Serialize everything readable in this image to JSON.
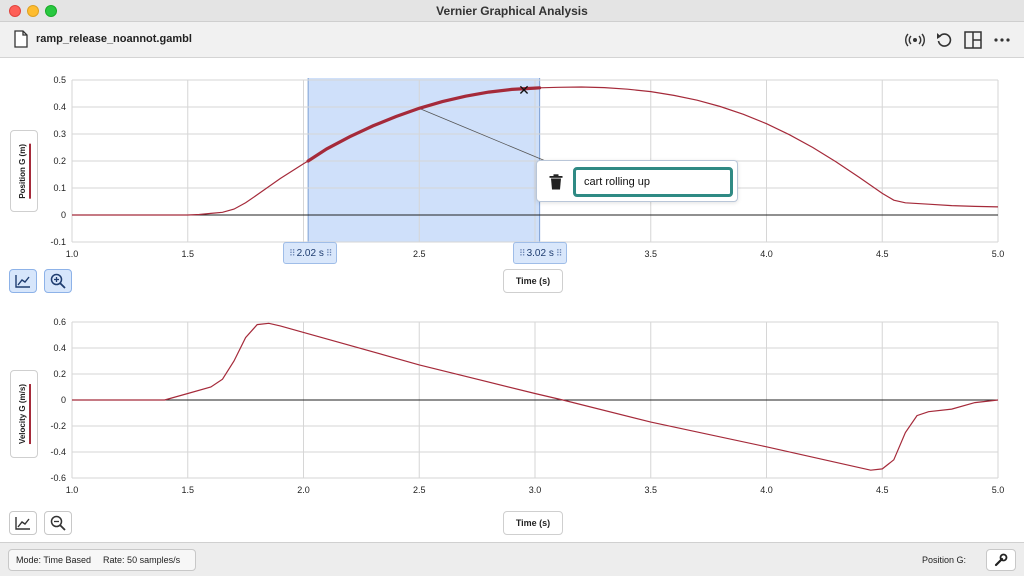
{
  "window": {
    "title": "Vernier Graphical Analysis"
  },
  "toolbar": {
    "file_name": "ramp_release_noannot.gambl",
    "icons": [
      "file-icon",
      "sensor-broadcast-icon",
      "undo-icon",
      "layout-icon",
      "more-icon"
    ]
  },
  "graph1": {
    "ylabel": "Position G (m)",
    "xlabel": "Time (s)",
    "selection": {
      "start_label": "2.02 s",
      "end_label": "3.02 s",
      "start": 2.02,
      "end": 3.02
    },
    "annotation": {
      "text": "cart rolling up"
    },
    "tools": [
      "graph-options-icon",
      "zoom-in-icon"
    ]
  },
  "graph2": {
    "ylabel": "Velocity G (m/s)",
    "xlabel": "Time (s)",
    "tools": [
      "graph-options-icon",
      "zoom-out-icon"
    ]
  },
  "status": {
    "mode": "Mode: Time Based",
    "rate": "Rate: 50 samples/s",
    "sensor_label": "Position G:"
  },
  "colors": {
    "trace": "#a52a3a",
    "selection": "#cfe0fa",
    "accent": "#2f8a84"
  },
  "chart_data": [
    {
      "type": "line",
      "xlabel": "Time (s)",
      "ylabel": "Position G (m)",
      "xlim": [
        1.0,
        5.0
      ],
      "ylim": [
        -0.1,
        0.5
      ],
      "xticks": [
        "1.0",
        "1.5",
        "2.0",
        "2.5",
        "3.0",
        "3.5",
        "4.0",
        "4.5",
        "5.0"
      ],
      "yticks": [
        "-0.1",
        "0",
        "0.1",
        "0.2",
        "0.3",
        "0.4",
        "0.5"
      ],
      "grid": true,
      "series": [
        {
          "x": [
            1.0,
            1.5,
            1.55,
            1.6,
            1.65,
            1.7,
            1.75,
            1.8,
            1.9,
            2.0,
            2.02,
            2.1,
            2.2,
            2.3,
            2.4,
            2.5,
            2.6,
            2.7,
            2.8,
            2.9,
            3.0,
            3.02,
            3.1,
            3.2,
            3.3,
            3.4,
            3.5,
            3.6,
            3.7,
            3.8,
            3.9,
            4.0,
            4.1,
            4.2,
            4.3,
            4.4,
            4.5,
            4.55,
            4.6,
            4.7,
            4.8,
            4.9,
            5.0
          ],
          "y": [
            0,
            0,
            0.002,
            0.006,
            0.01,
            0.022,
            0.045,
            0.075,
            0.135,
            0.19,
            0.2,
            0.245,
            0.29,
            0.33,
            0.365,
            0.395,
            0.42,
            0.44,
            0.455,
            0.465,
            0.47,
            0.471,
            0.473,
            0.474,
            0.472,
            0.466,
            0.457,
            0.443,
            0.425,
            0.402,
            0.373,
            0.338,
            0.297,
            0.25,
            0.197,
            0.14,
            0.08,
            0.055,
            0.045,
            0.04,
            0.035,
            0.032,
            0.03
          ]
        }
      ]
    },
    {
      "type": "line",
      "xlabel": "Time (s)",
      "ylabel": "Velocity G (m/s)",
      "xlim": [
        1.0,
        5.0
      ],
      "ylim": [
        -0.6,
        0.6
      ],
      "xticks": [
        "1.0",
        "1.5",
        "2.0",
        "2.5",
        "3.0",
        "3.5",
        "4.0",
        "4.5",
        "5.0"
      ],
      "yticks": [
        "-0.6",
        "-0.4",
        "-0.2",
        "0",
        "0.2",
        "0.4",
        "0.6"
      ],
      "grid": true,
      "series": [
        {
          "x": [
            1.0,
            1.4,
            1.5,
            1.6,
            1.65,
            1.7,
            1.75,
            1.8,
            1.85,
            1.9,
            2.0,
            2.5,
            3.0,
            3.12,
            3.5,
            4.0,
            4.45,
            4.5,
            4.55,
            4.6,
            4.65,
            4.7,
            4.8,
            4.9,
            5.0
          ],
          "y": [
            0,
            0,
            0.05,
            0.1,
            0.16,
            0.3,
            0.48,
            0.58,
            0.59,
            0.57,
            0.52,
            0.27,
            0.05,
            0,
            -0.17,
            -0.36,
            -0.54,
            -0.53,
            -0.46,
            -0.25,
            -0.12,
            -0.09,
            -0.07,
            -0.02,
            0
          ]
        }
      ]
    }
  ]
}
